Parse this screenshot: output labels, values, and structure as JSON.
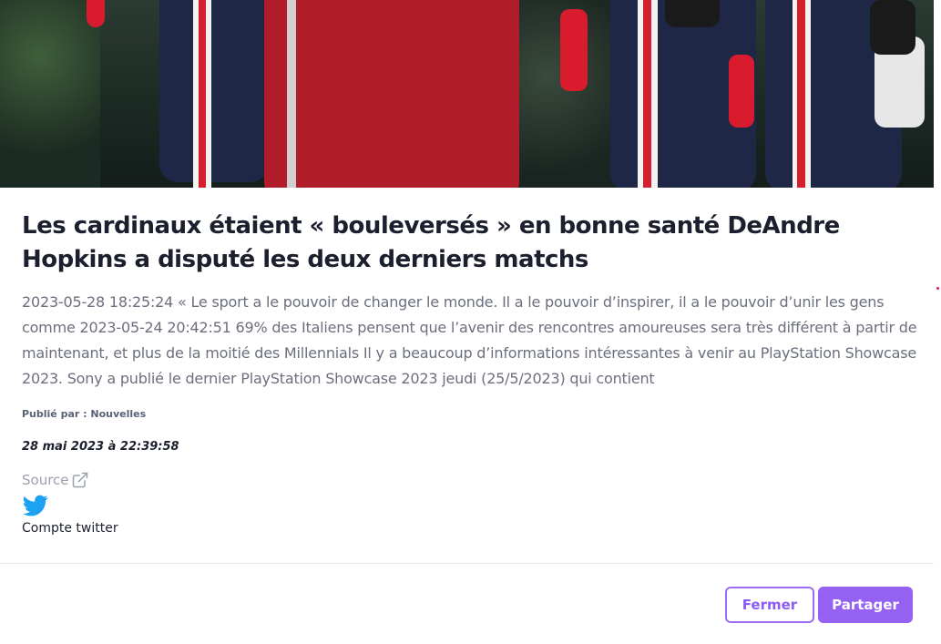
{
  "article": {
    "title": "Les cardinaux étaient « bouleversés » en bonne santé DeAndre Hopkins a disputé les deux derniers matchs",
    "excerpt": "2023-05-28 18:25:24 « Le sport a le pouvoir de changer le monde. Il a le pouvoir d’inspirer, il a le pouvoir d’unir les gens comme 2023-05-24 20:42:51 69% des Italiens pensent que l’avenir des rencontres amoureuses sera très différent à partir de maintenant, et plus de la moitié des Millennials Il y a beaucoup d’informations intéressantes à venir au PlayStation Showcase 2023. Sony a publié le dernier PlayStation Showcase 2023 jeudi (25/5/2023) qui contient",
    "published_by": "Publié par : Nouvelles",
    "date": "28 mai 2023 à 22:39:58",
    "source_label": "Source",
    "twitter_label": "Compte twitter"
  },
  "icons": {
    "source": "external-link-icon",
    "twitter": "twitter-bird-icon"
  },
  "buttons": {
    "close_label": "Fermer",
    "share_label": "Partager"
  },
  "colors": {
    "accent": "#9561f3",
    "twitter": "#1da1f2",
    "title": "#1c1f2e",
    "body_text": "#6b6f7e"
  }
}
